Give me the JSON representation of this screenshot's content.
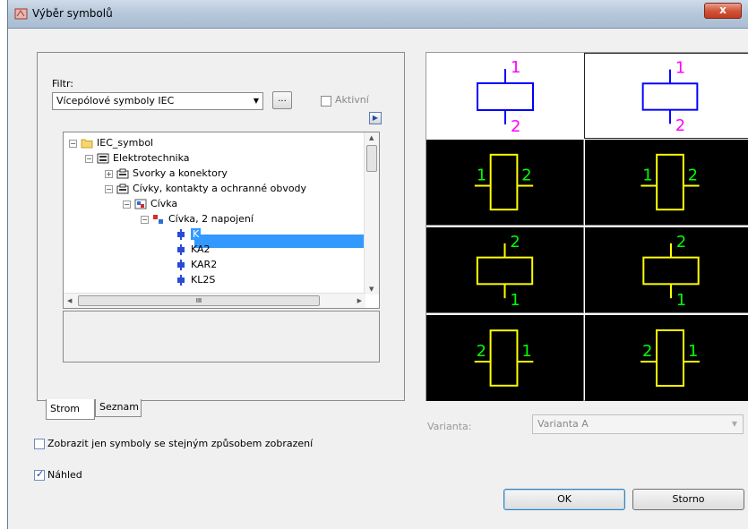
{
  "window": {
    "title": "Výběr symbolů",
    "close_label": "x"
  },
  "filter": {
    "label": "Filtr:",
    "selected": "Vícepólové symboly IEC",
    "browse_label": "...",
    "active_label": "Aktivní",
    "play_label": "▶"
  },
  "tree": {
    "items": [
      {
        "label": "IEC_symbol"
      },
      {
        "label": "Elektrotechnika"
      },
      {
        "label": "Svorky a konektory"
      },
      {
        "label": "Cívky, kontakty a ochranné obvody"
      },
      {
        "label": "Cívka"
      },
      {
        "label": "Cívka, 2 napojení"
      },
      {
        "label": "K"
      },
      {
        "label": "KA2"
      },
      {
        "label": "KAR2"
      },
      {
        "label": "KL2S"
      }
    ],
    "hscroll_grip": "III"
  },
  "tabs": {
    "strom": "Strom",
    "seznam": "Seznam"
  },
  "preview": {
    "cells": [
      {
        "top": "1",
        "bottom": "2"
      },
      {
        "top": "1",
        "bottom": "2"
      },
      {
        "left": "1",
        "right": "2"
      },
      {
        "left": "1",
        "right": "2"
      },
      {
        "top": "2",
        "bottom": "1"
      },
      {
        "top": "2",
        "bottom": "1"
      },
      {
        "left": "2",
        "right": "1"
      },
      {
        "left": "2",
        "right": "1"
      }
    ]
  },
  "variant": {
    "label": "Varianta:",
    "selected": "Varianta A"
  },
  "options": {
    "same_display_label": "Zobrazit jen symboly se stejným způsobem zobrazení",
    "same_display_checked": false,
    "preview_label": "Náhled",
    "preview_checked": true
  },
  "buttons": {
    "ok": "OK",
    "cancel": "Storno"
  },
  "colors": {
    "selection": "#3399ff",
    "symbol_blue": "#0000ff",
    "label_magenta": "#ff00ff",
    "symbol_yellow": "#ffff00",
    "label_green": "#00ff00"
  }
}
